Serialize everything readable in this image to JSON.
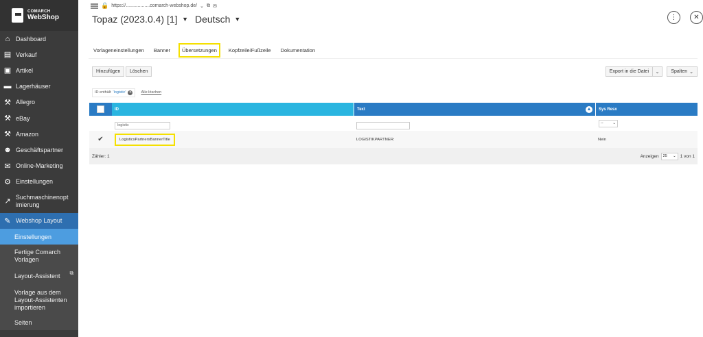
{
  "brand": {
    "line1": "COMARCH",
    "line2": "WebShop"
  },
  "sidebar": {
    "items": [
      {
        "label": "Dashboard",
        "icon": "home-icon"
      },
      {
        "label": "Verkauf",
        "icon": "document-icon"
      },
      {
        "label": "Artikel",
        "icon": "box-icon"
      },
      {
        "label": "Lagerhäuser",
        "icon": "truck-icon"
      },
      {
        "label": "Allegro",
        "icon": "gavel-icon"
      },
      {
        "label": "eBay",
        "icon": "gavel-icon"
      },
      {
        "label": "Amazon",
        "icon": "gavel-icon"
      },
      {
        "label": "Geschäftspartner",
        "icon": "users-icon"
      },
      {
        "label": "Online-Marketing",
        "icon": "envelope-icon"
      },
      {
        "label": "Einstellungen",
        "icon": "gear-icon"
      },
      {
        "label": "Suchmaschinenopt imierung",
        "icon": "chart-icon"
      },
      {
        "label": "Webshop Layout",
        "icon": "brush-icon"
      }
    ],
    "subitems": [
      {
        "label": "Einstellungen"
      },
      {
        "label": "Fertige Comarch Vorlagen"
      },
      {
        "label": "Layout-Assistent"
      },
      {
        "label": "Vorlage aus dem Layout-Assistenten importieren"
      },
      {
        "label": "Seiten"
      }
    ]
  },
  "topbar": {
    "url": "https://..................comarch-webshop.de/",
    "store": "Topaz (2023.0.4) [1]",
    "language": "Deutsch",
    "settings_icon": "traffic-light-icon",
    "close_icon": "close-icon"
  },
  "tabs": [
    {
      "label": "Vorlageneinstellungen"
    },
    {
      "label": "Banner"
    },
    {
      "label": "Übersetzungen"
    },
    {
      "label": "Kopfzeile/Fußzeile"
    },
    {
      "label": "Dokumentation"
    }
  ],
  "toolbar": {
    "add": "Hinzufügen",
    "delete": "Löschen",
    "export": "Export in die Datei",
    "columns": "Spalten"
  },
  "filter": {
    "prefix": "ID enthält",
    "value": "'logistic'",
    "clear": "Alle löschen"
  },
  "grid": {
    "headers": {
      "id": "ID",
      "text": "Text",
      "sys": "Sys Resx"
    },
    "filters": {
      "id": "logistic",
      "text": "",
      "sys": "--"
    },
    "rows": [
      {
        "id": "LogisticsPartnersBannerTitle",
        "text": "LOGISTIKPARTNER:",
        "sys": "Nein",
        "checked": true
      }
    ],
    "counter": "Zähler: 1",
    "pager": {
      "label": "Anzeigen",
      "per_page": "25",
      "range": "1 von 1"
    }
  }
}
